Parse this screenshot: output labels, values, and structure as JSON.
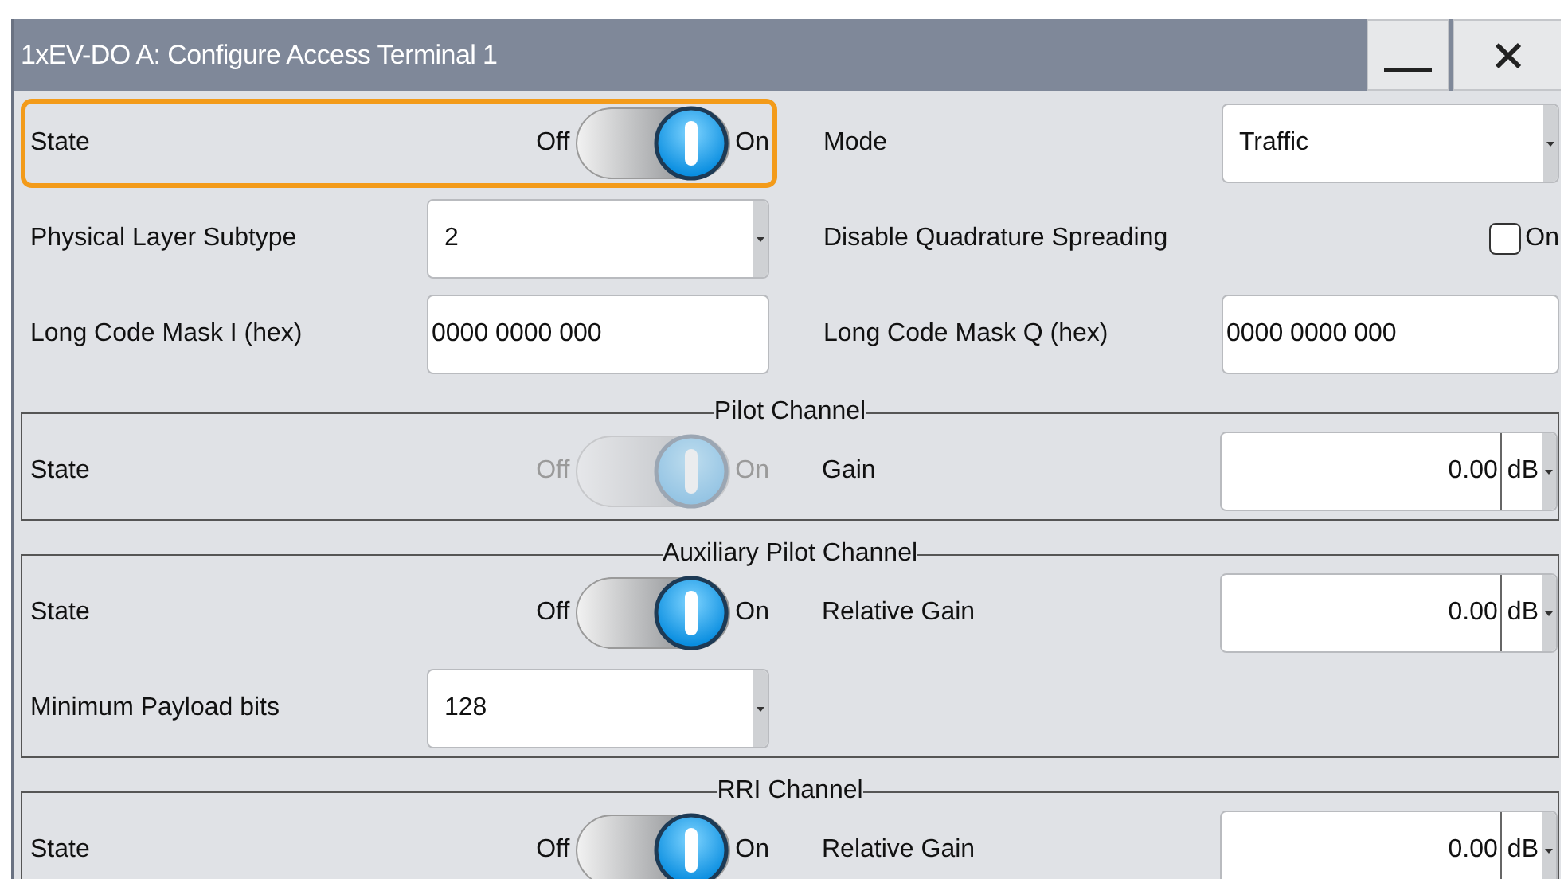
{
  "window": {
    "title": "1xEV-DO A: Configure Access Terminal 1"
  },
  "top_rows": [
    [
      {
        "kind": "toggle",
        "label": "State",
        "off_label": "Off",
        "on_label": "On",
        "on": true,
        "disabled": false,
        "focused": true
      },
      {
        "kind": "dropdown",
        "label": "Mode",
        "value": "Traffic"
      }
    ],
    [
      {
        "kind": "dropdown",
        "label": "Physical Layer Subtype",
        "value": "2"
      },
      {
        "kind": "checkbox",
        "label": "Disable Quadrature Spreading",
        "checked": false,
        "text": "On"
      }
    ],
    [
      {
        "kind": "text",
        "label": "Long Code Mask I (hex)",
        "value": "0000 0000 000"
      },
      {
        "kind": "text",
        "label": "Long Code Mask Q (hex)",
        "value": "0000 0000 000"
      }
    ]
  ],
  "groups": [
    {
      "title": "Pilot Channel",
      "rows": [
        [
          {
            "kind": "toggle",
            "label": "State",
            "off_label": "Off",
            "on_label": "On",
            "on": true,
            "disabled": true
          },
          {
            "kind": "gain",
            "label": "Gain",
            "value": "0.00",
            "unit": "dB"
          }
        ]
      ]
    },
    {
      "title": "Auxiliary Pilot Channel",
      "rows": [
        [
          {
            "kind": "toggle",
            "label": "State",
            "off_label": "Off",
            "on_label": "On",
            "on": true,
            "disabled": false
          },
          {
            "kind": "gain",
            "label": "Relative Gain",
            "value": "0.00",
            "unit": "dB"
          }
        ],
        [
          {
            "kind": "dropdown",
            "label": "Minimum Payload bits",
            "value": "128"
          }
        ]
      ]
    },
    {
      "title": "RRI Channel",
      "rows": [
        [
          {
            "kind": "toggle",
            "label": "State",
            "off_label": "Off",
            "on_label": "On",
            "on": true,
            "disabled": false
          },
          {
            "kind": "gain",
            "label": "Relative Gain",
            "value": "0.00",
            "unit": "dB"
          }
        ]
      ]
    }
  ]
}
